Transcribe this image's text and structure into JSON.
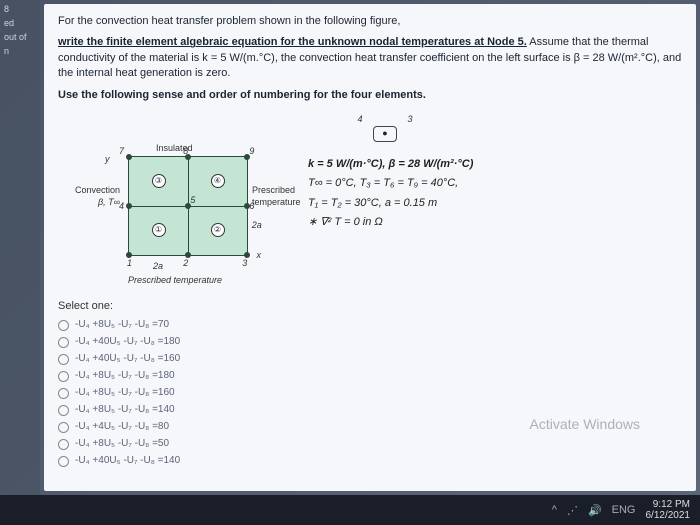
{
  "leftcol": {
    "tag1": "8",
    "tag2": "ed",
    "tag3": "out of",
    "tag4": "n"
  },
  "prompt": {
    "line1": "For the convection heat transfer problem shown in the following figure,",
    "line2a": "write the finite element algebraic equation for the unknown nodal temperatures at Node 5.",
    "line2b": " Assume that the thermal conductivity of the material is k = 5 W/(m.°C), the convection heat transfer coefficient on the left surface is β = 28 W/(m².°C), and the internal heat generation is zero.",
    "instruct": "Use the following sense and order of numbering for the four elements."
  },
  "figure": {
    "insulated": "Insulated",
    "convection": "Convection",
    "bt": "β, T∞",
    "prescribed": "Prescribed",
    "temperature": "temperature",
    "presc_temp_bottom": "Prescribed temperature",
    "two_a": "2a",
    "nodes": {
      "n1": "1",
      "n2": "2",
      "n3": "3",
      "n4": "4",
      "n5": "5",
      "n6": "6",
      "n7": "7",
      "n8": "8",
      "n9": "9"
    },
    "elems": {
      "e1": "①",
      "e2": "②",
      "e3": "③",
      "e4": "④"
    },
    "x": "x",
    "y": "y"
  },
  "params": {
    "p1": "k = 5 W/(m·°C), β = 28 W/(m²·°C)",
    "p2": "T∞ = 0°C, T₃ = T₆ = T₉ = 40°C,",
    "p3": "T₁ = T₂ = 30°C, a = 0.15 m",
    "p4": "∗ ∇² T = 0 in Ω"
  },
  "options": {
    "title": "Select one:",
    "items": [
      "-U₄ +8U₅ -U₇ -U₈ =70",
      "-U₄ +40U₅ -U₇ -U₈ =180",
      "-U₄ +40U₅ -U₇ -U₈ =160",
      "-U₄ +8U₅ -U₇ -U₈ =180",
      "-U₄ +8U₅ -U₇ -U₈ =160",
      "-U₄ +8U₅ -U₇ -U₈ =140",
      "-U₄ +4U₅ -U₇ -U₈ =80",
      "-U₄ +8U₅ -U₇ -U₈ =50",
      "-U₄ +40U₅ -U₇ -U₈ =140"
    ]
  },
  "watermark": "Activate Windows",
  "taskbar": {
    "up": "^",
    "wifi": "⋰",
    "sound": "🔊",
    "lang": "ENG",
    "time": "9:12 PM",
    "date": "6/12/2021"
  }
}
